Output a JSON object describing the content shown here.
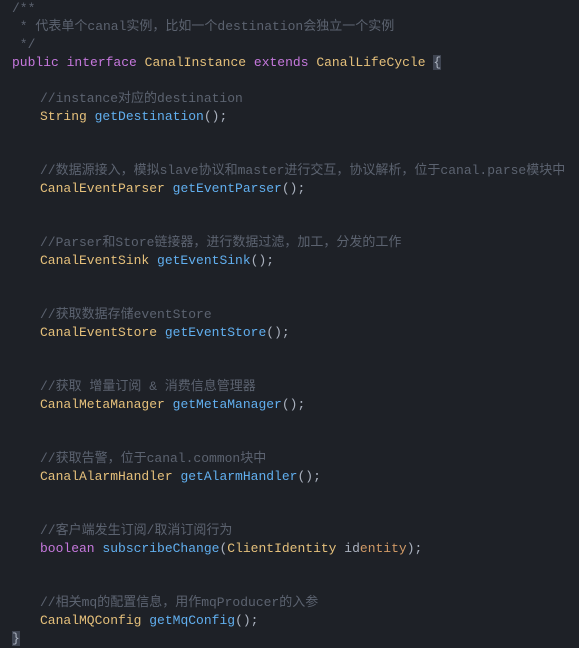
{
  "code": {
    "line1": "/**",
    "line2": " * 代表单个canal实例，比如一个destination会独立一个实例",
    "line3": " */",
    "kw_public": "public",
    "kw_interface": "interface",
    "type_canal_instance": "CanalInstance",
    "kw_extends": "extends",
    "type_canal_lifecycle": "CanalLifeCycle",
    "brace_open": "{",
    "comment_dest": "//instance对应的destination",
    "type_string": "String",
    "method_get_dest": "getDestination",
    "parens_semi": "();",
    "comment_parser": "//数据源接入，模拟slave协议和master进行交互，协议解析，位于canal.parse模块中",
    "type_event_parser": "CanalEventParser",
    "method_get_event_parser": "getEventParser",
    "comment_sink": "//Parser和Store链接器，进行数据过滤，加工，分发的工作",
    "type_event_sink": "CanalEventSink",
    "method_get_event_sink": "getEventSink",
    "comment_store": "//获取数据存储eventStore",
    "type_event_store": "CanalEventStore",
    "method_get_event_store": "getEventStore",
    "comment_meta": "//获取 增量订阅 & 消费信息管理器",
    "type_meta_manager": "CanalMetaManager",
    "method_get_meta_manager": "getMetaManager",
    "comment_alarm": "//获取告警，位于canal.common块中",
    "type_alarm_handler": "CanalAlarmHandler",
    "method_get_alarm_handler": "getAlarmHandler",
    "comment_subscribe": "//客户端发生订阅/取消订阅行为",
    "type_boolean": "boolean",
    "method_subscribe_change": "subscribeChange",
    "paren_open": "(",
    "type_client_identity": "ClientIdentity",
    "param_id_prefix": " id",
    "param_entity": "entity",
    "paren_close_semi": ");",
    "comment_mq": "//相关mq的配置信息，用作mqProducer的入参",
    "type_mq_config": "CanalMQConfig",
    "method_get_mq_config": "getMqConfig",
    "brace_close": "}"
  }
}
